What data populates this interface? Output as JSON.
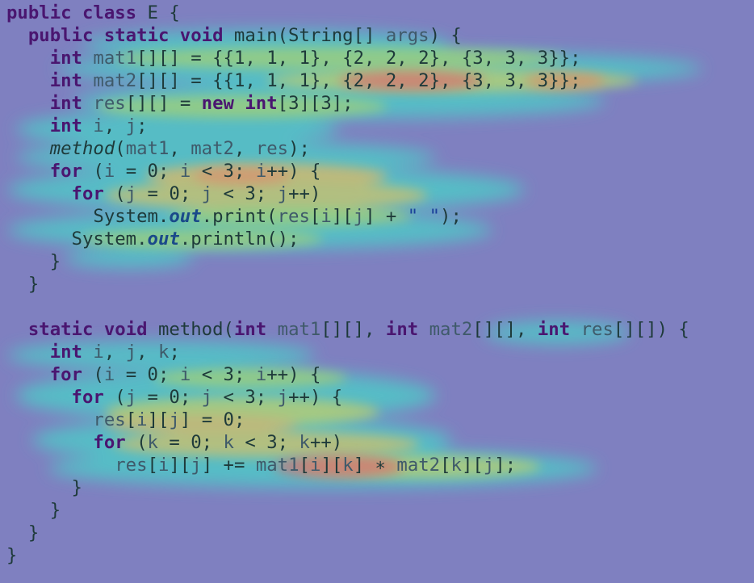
{
  "colors": {
    "background": "#7f80c0",
    "heat_low": "#4fc7c7",
    "heat_mid": "#9fcf7a",
    "heat_warm": "#d7b86a",
    "heat_high": "#d87070",
    "keyword": "#4a1670",
    "text": "#1e3a3a"
  },
  "code_lines": [
    [
      {
        "t": "public class",
        "c": "kw"
      },
      {
        "t": " E {"
      }
    ],
    [
      {
        "t": "  "
      },
      {
        "t": "public static void",
        "c": "kw"
      },
      {
        "t": " main(String[] "
      },
      {
        "t": "args",
        "c": "var"
      },
      {
        "t": ") {"
      }
    ],
    [
      {
        "t": "    "
      },
      {
        "t": "int",
        "c": "typ"
      },
      {
        "t": " "
      },
      {
        "t": "mat1",
        "c": "var"
      },
      {
        "t": "[][] = {{1, 1, 1}, {2, 2, 2}, {3, 3, 3}};"
      }
    ],
    [
      {
        "t": "    "
      },
      {
        "t": "int",
        "c": "typ"
      },
      {
        "t": " "
      },
      {
        "t": "mat2",
        "c": "var"
      },
      {
        "t": "[][] = {{1, 1, 1}, {2, 2, 2}, {3, 3, 3}};"
      }
    ],
    [
      {
        "t": "    "
      },
      {
        "t": "int",
        "c": "typ"
      },
      {
        "t": " "
      },
      {
        "t": "res",
        "c": "var"
      },
      {
        "t": "[][] = "
      },
      {
        "t": "new int",
        "c": "kw"
      },
      {
        "t": "[3][3];"
      }
    ],
    [
      {
        "t": "    "
      },
      {
        "t": "int",
        "c": "typ"
      },
      {
        "t": " "
      },
      {
        "t": "i",
        "c": "var"
      },
      {
        "t": ", "
      },
      {
        "t": "j",
        "c": "var"
      },
      {
        "t": ";"
      }
    ],
    [
      {
        "t": "    "
      },
      {
        "t": "method",
        "c": "ital"
      },
      {
        "t": "("
      },
      {
        "t": "mat1",
        "c": "var"
      },
      {
        "t": ", "
      },
      {
        "t": "mat2",
        "c": "var"
      },
      {
        "t": ", "
      },
      {
        "t": "res",
        "c": "var"
      },
      {
        "t": ");"
      }
    ],
    [
      {
        "t": "    "
      },
      {
        "t": "for",
        "c": "kw"
      },
      {
        "t": " ("
      },
      {
        "t": "i",
        "c": "var"
      },
      {
        "t": " = 0; "
      },
      {
        "t": "i",
        "c": "var"
      },
      {
        "t": " < 3; "
      },
      {
        "t": "i",
        "c": "var"
      },
      {
        "t": "++) {"
      }
    ],
    [
      {
        "t": "      "
      },
      {
        "t": "for",
        "c": "kw"
      },
      {
        "t": " ("
      },
      {
        "t": "j",
        "c": "var"
      },
      {
        "t": " = 0; "
      },
      {
        "t": "j",
        "c": "var"
      },
      {
        "t": " < 3; "
      },
      {
        "t": "j",
        "c": "var"
      },
      {
        "t": "++)"
      }
    ],
    [
      {
        "t": "        System."
      },
      {
        "t": "out",
        "c": "fld"
      },
      {
        "t": ".print("
      },
      {
        "t": "res",
        "c": "var"
      },
      {
        "t": "["
      },
      {
        "t": "i",
        "c": "var"
      },
      {
        "t": "]["
      },
      {
        "t": "j",
        "c": "var"
      },
      {
        "t": "] + "
      },
      {
        "t": "\" \"",
        "c": "str"
      },
      {
        "t": ");"
      }
    ],
    [
      {
        "t": "      System."
      },
      {
        "t": "out",
        "c": "fld"
      },
      {
        "t": ".println();"
      }
    ],
    [
      {
        "t": "    }"
      }
    ],
    [
      {
        "t": "  }"
      }
    ],
    [
      {
        "t": ""
      }
    ],
    [
      {
        "t": "  "
      },
      {
        "t": "static void",
        "c": "kw"
      },
      {
        "t": " method("
      },
      {
        "t": "int",
        "c": "typ"
      },
      {
        "t": " "
      },
      {
        "t": "mat1",
        "c": "var"
      },
      {
        "t": "[][], "
      },
      {
        "t": "int",
        "c": "typ"
      },
      {
        "t": " "
      },
      {
        "t": "mat2",
        "c": "var"
      },
      {
        "t": "[][], "
      },
      {
        "t": "int",
        "c": "typ"
      },
      {
        "t": " "
      },
      {
        "t": "res",
        "c": "var"
      },
      {
        "t": "[][]) {"
      }
    ],
    [
      {
        "t": "    "
      },
      {
        "t": "int",
        "c": "typ"
      },
      {
        "t": " "
      },
      {
        "t": "i",
        "c": "var"
      },
      {
        "t": ", "
      },
      {
        "t": "j",
        "c": "var"
      },
      {
        "t": ", "
      },
      {
        "t": "k",
        "c": "var"
      },
      {
        "t": ";"
      }
    ],
    [
      {
        "t": "    "
      },
      {
        "t": "for",
        "c": "kw"
      },
      {
        "t": " ("
      },
      {
        "t": "i",
        "c": "var"
      },
      {
        "t": " = 0; "
      },
      {
        "t": "i",
        "c": "var"
      },
      {
        "t": " < 3; "
      },
      {
        "t": "i",
        "c": "var"
      },
      {
        "t": "++) {"
      }
    ],
    [
      {
        "t": "      "
      },
      {
        "t": "for",
        "c": "kw"
      },
      {
        "t": " ("
      },
      {
        "t": "j",
        "c": "var"
      },
      {
        "t": " = 0; "
      },
      {
        "t": "j",
        "c": "var"
      },
      {
        "t": " < 3; "
      },
      {
        "t": "j",
        "c": "var"
      },
      {
        "t": "++) {"
      }
    ],
    [
      {
        "t": "        "
      },
      {
        "t": "res",
        "c": "var"
      },
      {
        "t": "["
      },
      {
        "t": "i",
        "c": "var"
      },
      {
        "t": "]["
      },
      {
        "t": "j",
        "c": "var"
      },
      {
        "t": "] = 0;"
      }
    ],
    [
      {
        "t": "        "
      },
      {
        "t": "for",
        "c": "kw"
      },
      {
        "t": " ("
      },
      {
        "t": "k",
        "c": "var"
      },
      {
        "t": " = 0; "
      },
      {
        "t": "k",
        "c": "var"
      },
      {
        "t": " < 3; "
      },
      {
        "t": "k",
        "c": "var"
      },
      {
        "t": "++)"
      }
    ],
    [
      {
        "t": "          "
      },
      {
        "t": "res",
        "c": "var"
      },
      {
        "t": "["
      },
      {
        "t": "i",
        "c": "var"
      },
      {
        "t": "]["
      },
      {
        "t": "j",
        "c": "var"
      },
      {
        "t": "] += "
      },
      {
        "t": "mat1",
        "c": "var"
      },
      {
        "t": "["
      },
      {
        "t": "i",
        "c": "var"
      },
      {
        "t": "]["
      },
      {
        "t": "k",
        "c": "var"
      },
      {
        "t": "] ∗ "
      },
      {
        "t": "mat2",
        "c": "var"
      },
      {
        "t": "["
      },
      {
        "t": "k",
        "c": "var"
      },
      {
        "t": "]["
      },
      {
        "t": "j",
        "c": "var"
      },
      {
        "t": "];"
      }
    ],
    [
      {
        "t": "      }"
      }
    ],
    [
      {
        "t": "    }"
      }
    ],
    [
      {
        "t": "  }"
      }
    ],
    [
      {
        "t": "}"
      }
    ]
  ]
}
